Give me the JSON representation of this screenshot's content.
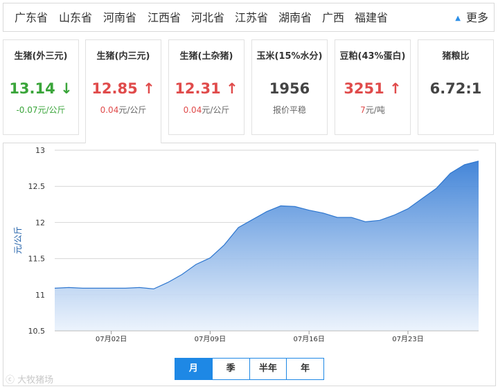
{
  "provinces": [
    "广东省",
    "山东省",
    "河南省",
    "江西省",
    "河北省",
    "江苏省",
    "湖南省",
    "广西",
    "福建省"
  ],
  "more_label": "更多",
  "cards": [
    {
      "title": "生猪(外三元)",
      "price": "13.14",
      "arrow": "↓",
      "change": "-0.07元/公斤",
      "trend": "down"
    },
    {
      "title": "生猪(内三元)",
      "price": "12.85",
      "arrow": "↑",
      "change_value": "0.04",
      "change_unit": "元/公斤",
      "trend": "up"
    },
    {
      "title": "生猪(土杂猪)",
      "price": "12.31",
      "arrow": "↑",
      "change_value": "0.04",
      "change_unit": "元/公斤",
      "trend": "up"
    },
    {
      "title": "玉米(15%水分)",
      "price": "1956",
      "arrow": "",
      "change": "报价平稳",
      "trend": "flat"
    },
    {
      "title": "豆粕(43%蛋白)",
      "price": "3251",
      "arrow": "↑",
      "change_value": "7",
      "change_unit": "元/吨",
      "trend": "up"
    },
    {
      "title": "猪粮比",
      "price": "6.72:1",
      "arrow": "",
      "change": "",
      "trend": "flat"
    }
  ],
  "periods": [
    "月",
    "季",
    "半年",
    "年"
  ],
  "active_period": "月",
  "watermark": "大牧猪场",
  "colors": {
    "up": "#e04b4b",
    "down": "#3aa53a",
    "accent": "#1e88e5",
    "area_top": "#3a7fd6",
    "area_bottom": "#eaf2fc"
  },
  "chart_data": {
    "type": "area",
    "ylabel": "元/公斤",
    "xlabel": "",
    "ylim": [
      10.5,
      13
    ],
    "yticks": [
      10.5,
      11,
      11.5,
      12,
      12.5,
      13
    ],
    "xtick_labels": [
      "07月02日",
      "07月09日",
      "07月16日",
      "07月23日"
    ],
    "grid": true,
    "x": [
      "06月28日",
      "06月29日",
      "06月30日",
      "07月01日",
      "07月02日",
      "07月03日",
      "07月04日",
      "07月05日",
      "07月06日",
      "07月07日",
      "07月08日",
      "07月09日",
      "07月10日",
      "07月11日",
      "07月12日",
      "07月13日",
      "07月14日",
      "07月15日",
      "07月16日",
      "07月17日",
      "07月18日",
      "07月19日",
      "07月20日",
      "07月21日",
      "07月22日",
      "07月23日",
      "07月24日",
      "07月25日",
      "07月26日",
      "07月27日",
      "07月28日"
    ],
    "values": [
      11.09,
      11.1,
      11.09,
      11.09,
      11.09,
      11.09,
      11.1,
      11.08,
      11.17,
      11.28,
      11.42,
      11.51,
      11.69,
      11.93,
      12.04,
      12.15,
      12.23,
      12.22,
      12.17,
      12.13,
      12.07,
      12.07,
      12.01,
      12.03,
      12.1,
      12.19,
      12.33,
      12.47,
      12.68,
      12.8,
      12.85
    ]
  }
}
